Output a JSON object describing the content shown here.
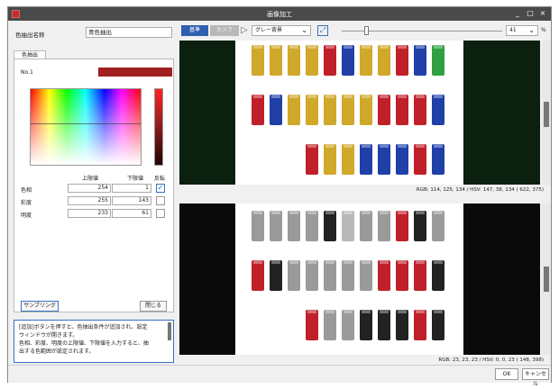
{
  "window": {
    "title": "画像加工"
  },
  "left_panel": {
    "name_label": "色抽出名称",
    "name_value": "青色抽出",
    "tab_label": "色抽出",
    "item_label": "No.1",
    "swatch_color": "#a32020",
    "header_upper": "上限値",
    "header_lower": "下限値",
    "header_invert": "反転",
    "rows": [
      {
        "label": "色相",
        "upper": "254",
        "lower": "1",
        "inverted": true
      },
      {
        "label": "彩度",
        "upper": "255",
        "lower": "143",
        "inverted": false
      },
      {
        "label": "明度",
        "upper": "233",
        "lower": "61",
        "inverted": false
      }
    ],
    "sampling_button": "サンプリング",
    "close_button": "閉じる",
    "note_lines": [
      "[追加]ボタンを押すと、色抽出条件が追加され、設定",
      "ウィンドウが開きます。",
      "色相、彩度、明度の上限値、下限値を入力すると、抽",
      "出する色範囲が設定されます。"
    ]
  },
  "toolbar": {
    "btn_kijun": "基準",
    "btn_camera": "カメラ",
    "mode_select": "グレー背景",
    "zoom_value": "41",
    "zoom_unit": "%"
  },
  "status": {
    "top": "RGB:  114,  125,  134 / HSV:  147,   38,  134 (  622,   375)",
    "bottom": "RGB:   23,   23,   23 / HSV:    0,    0,   23 (  148,   398)"
  },
  "footer": {
    "ok": "OK",
    "cancel": "キャンセル"
  },
  "fuse_colors": {
    "yellow": "#d0a82a",
    "red": "#c0202a",
    "blue": "#2040a8",
    "green": "#30a040",
    "gray": "#9a9a9a",
    "black": "#222222",
    "silver": "#b8b8b8"
  }
}
